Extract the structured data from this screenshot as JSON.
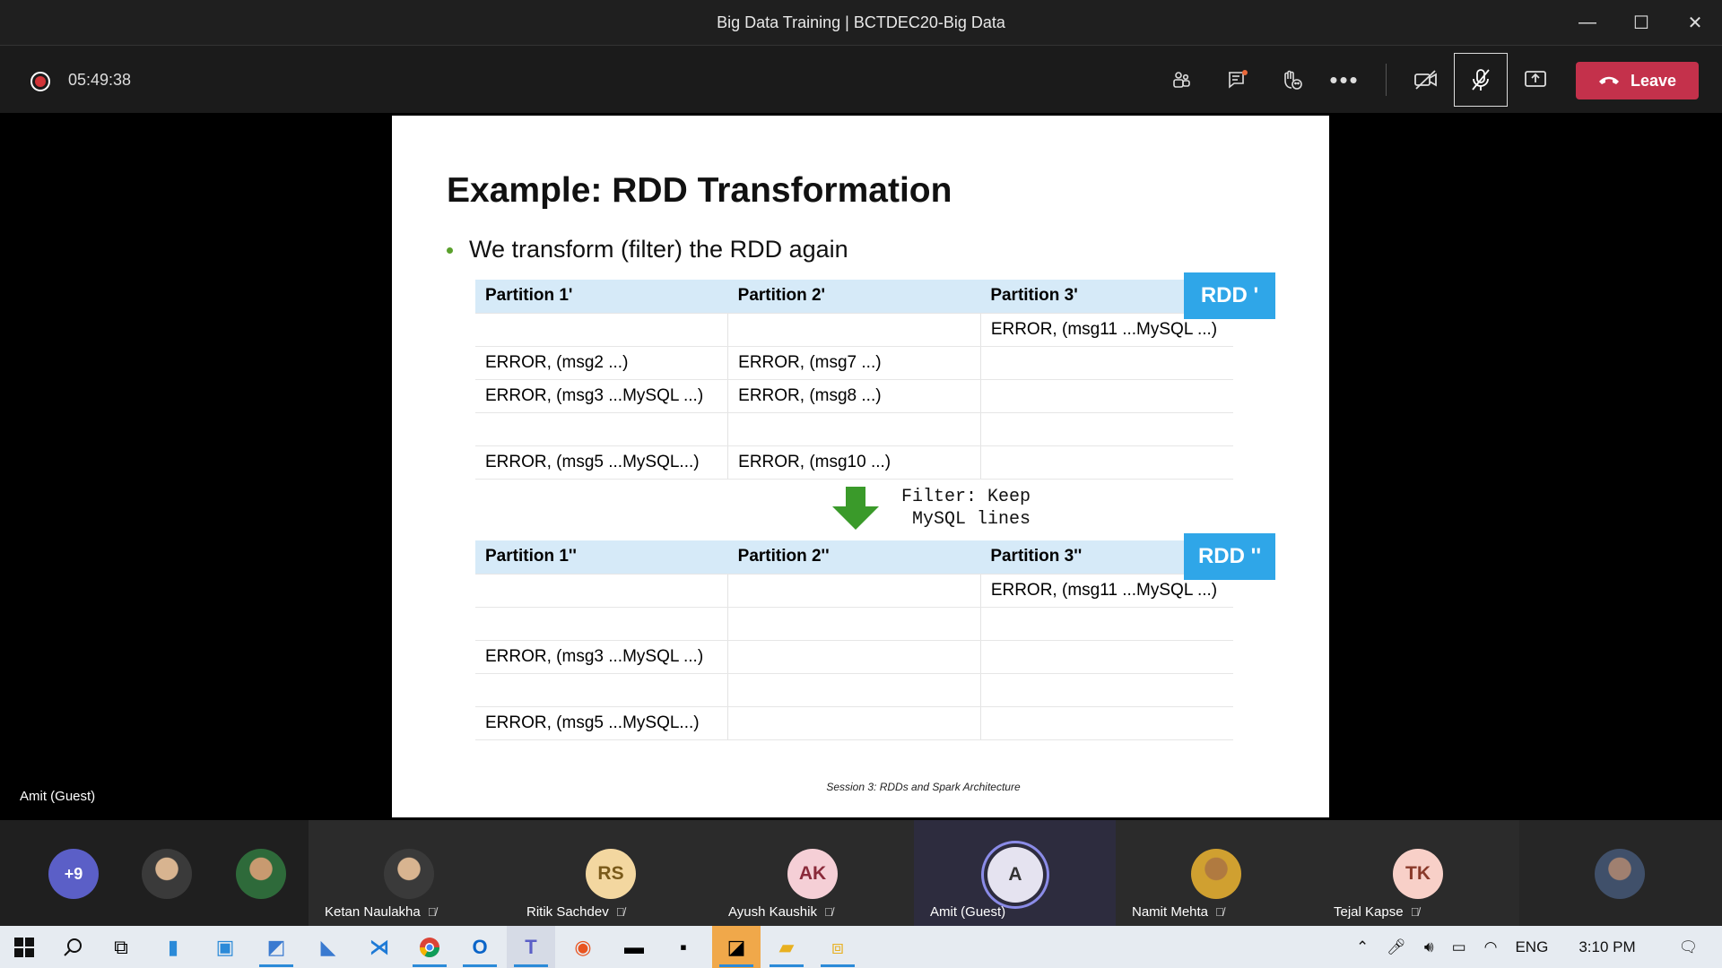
{
  "window": {
    "title": "Big Data Training | BCTDEC20-Big Data",
    "minimize": "—",
    "maximize": "☐",
    "close": "✕"
  },
  "toolbar": {
    "timer": "05:49:38",
    "leave_label": "Leave"
  },
  "stage": {
    "presenter_name": "Amit (Guest)"
  },
  "slide": {
    "title": "Example: RDD Transformation",
    "bullet": "We transform (filter) the RDD again",
    "rdd1": {
      "badge": "RDD '",
      "headers": [
        "Partition 1'",
        "Partition 2'",
        "Partition 3'"
      ],
      "rows": [
        [
          "",
          "",
          "ERROR, (msg11 ...MySQL ...)"
        ],
        [
          "ERROR, (msg2 ...)",
          "ERROR, (msg7 ...)",
          ""
        ],
        [
          "ERROR, (msg3 ...MySQL ...)",
          "ERROR, (msg8 ...)",
          ""
        ],
        [
          "",
          "",
          ""
        ],
        [
          "ERROR, (msg5 ...MySQL...)",
          "ERROR, (msg10 ...)",
          ""
        ]
      ]
    },
    "filter_text": "Filter: Keep\n MySQL lines",
    "rdd2": {
      "badge": "RDD ''",
      "headers": [
        "Partition 1''",
        "Partition 2''",
        "Partition 3''"
      ],
      "rows": [
        [
          "",
          "",
          "ERROR, (msg11 ...MySQL ...)"
        ],
        [
          "",
          "",
          ""
        ],
        [
          "ERROR, (msg3 ...MySQL ...)",
          "",
          ""
        ],
        [
          "",
          "",
          ""
        ],
        [
          "ERROR, (msg5 ...MySQL...)",
          "",
          ""
        ]
      ]
    },
    "footer": "Session 3: RDDs and Spark Architecture",
    "colors": {
      "header_bg": "#d6eaf8",
      "badge_bg": "#2fa6e8",
      "arrow": "#3a9a2a"
    }
  },
  "participants": {
    "overflow": "+9",
    "tiles": [
      {
        "name": "Ketan Naulakha",
        "initials": "",
        "color": ""
      },
      {
        "name": "Ritik Sachdev",
        "initials": "RS",
        "color": "#f3d7a0"
      },
      {
        "name": "Ayush Kaushik",
        "initials": "AK",
        "color": "#f5cfd6"
      },
      {
        "name": "Amit (Guest)",
        "initials": "A",
        "color": "#e5e3f0"
      },
      {
        "name": "Namit Mehta",
        "initials": "",
        "color": ""
      },
      {
        "name": "Tejal Kapse",
        "initials": "TK",
        "color": "#f8d0c8"
      }
    ]
  },
  "taskbar": {
    "language": "ENG",
    "time": "3:10 PM"
  }
}
